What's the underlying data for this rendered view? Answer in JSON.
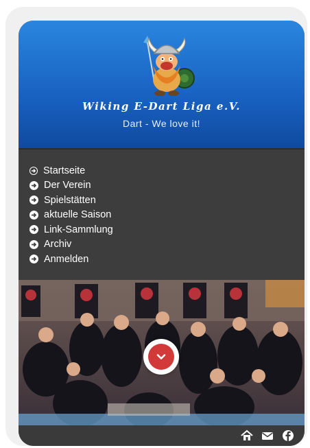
{
  "header": {
    "title": "Wiking E-Dart Liga e.V.",
    "tagline": "Dart - We love it!"
  },
  "nav": {
    "items": [
      {
        "label": "Startseite",
        "icon": "circle-arrow-right-outline-icon"
      },
      {
        "label": "Der Verein",
        "icon": "circle-arrow-right-icon"
      },
      {
        "label": "Spielstätten",
        "icon": "circle-arrow-right-icon"
      },
      {
        "label": "aktuelle Saison",
        "icon": "circle-arrow-right-icon"
      },
      {
        "label": "Link-Sammlung",
        "icon": "circle-arrow-right-icon"
      },
      {
        "label": "Archiv",
        "icon": "circle-arrow-right-icon"
      },
      {
        "label": "Anmelden",
        "icon": "circle-arrow-right-icon"
      }
    ]
  },
  "hero": {
    "image": "dart-tournament-crowd-photo",
    "scroll_button_icon": "chevron-down-icon"
  },
  "footer": {
    "icons": [
      "home-icon",
      "envelope-icon",
      "facebook-icon"
    ]
  },
  "colors": {
    "header_blue": "#1a64c4",
    "nav_bg": "#3d3d3d",
    "accent_red": "#d23a3a"
  }
}
